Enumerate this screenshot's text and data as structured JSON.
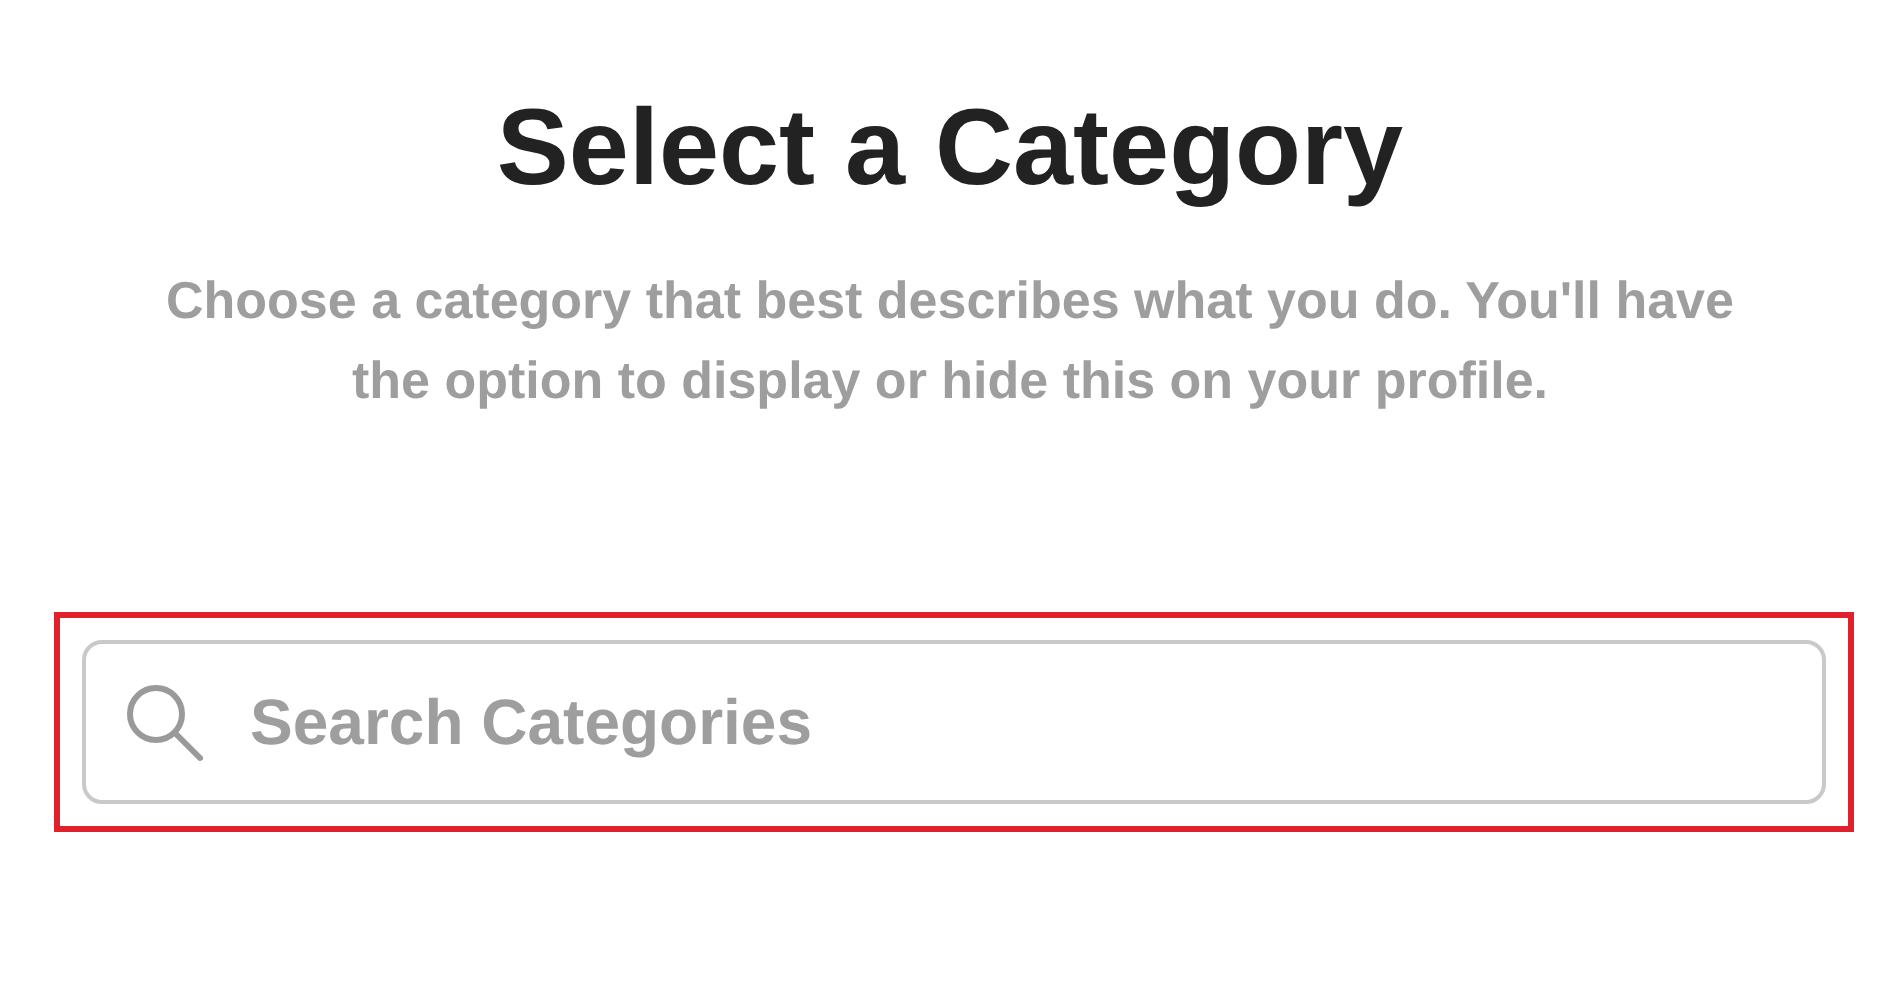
{
  "title": "Select a Category",
  "description": "Choose a category that best describes what you do. You'll have the option to display or hide this on your profile.",
  "search": {
    "placeholder": "Search Categories",
    "highlighted": true
  }
}
